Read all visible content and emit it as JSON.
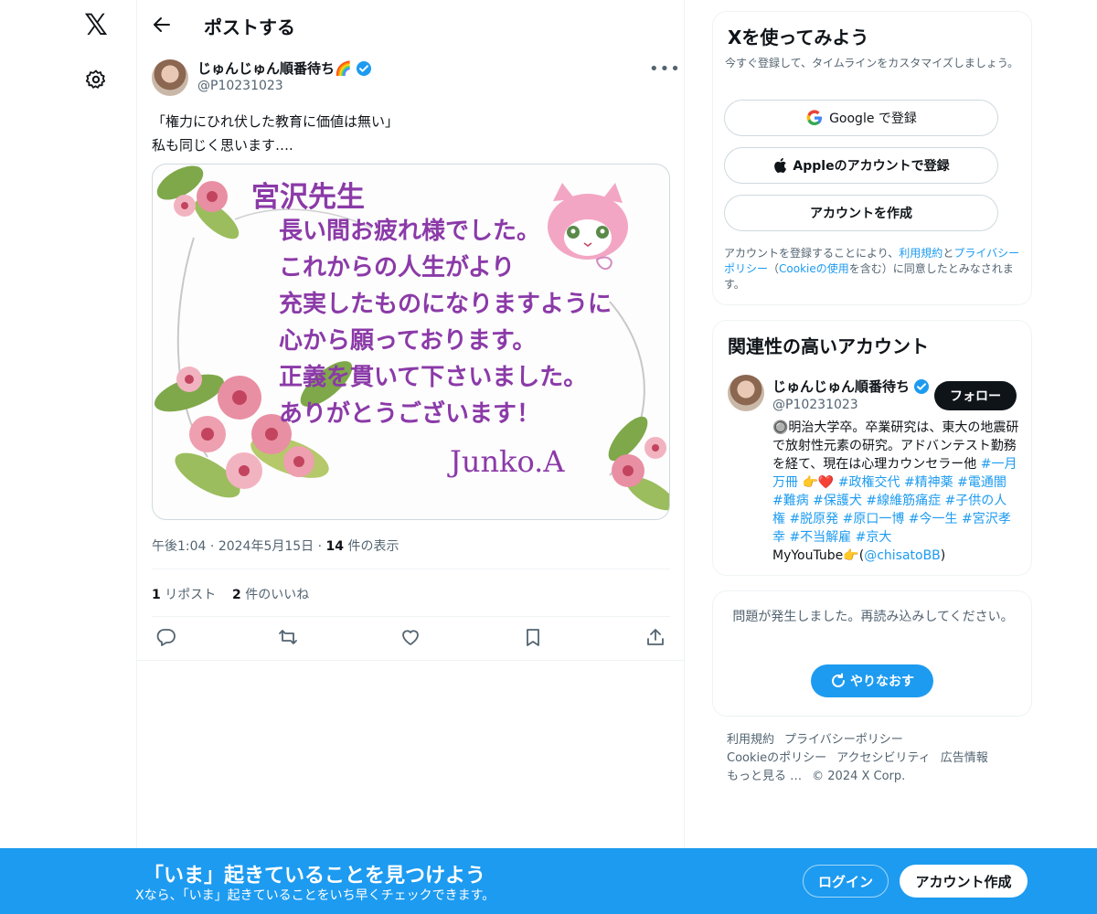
{
  "nav": {
    "logo_text": "𝕏"
  },
  "header": {
    "title": "ポストする"
  },
  "post": {
    "author_name": "じゅんじゅん順番待ち🌈",
    "author_handle": "@P10231023",
    "text_lines": [
      "「権力にひれ伏した教育に価値は無い」",
      "私も同じく思います….",
      ""
    ],
    "image_lines": [
      "宮沢先生",
      "長い間お疲れ様でした。",
      "これからの人生がより",
      "充実したものになりますように",
      "心から願っております。",
      "正義を貫いて下さいました。",
      "ありがとうございます！",
      "Junko.A"
    ],
    "time": "午後1:04",
    "date": "2024年5月15日",
    "views_count": "14",
    "views_label": "件の表示",
    "reposts_count": "1",
    "reposts_label": "リポスト",
    "likes_count": "2",
    "likes_label": "件のいいね"
  },
  "signup_box": {
    "title": "Xを使ってみよう",
    "subtitle": "今すぐ登録して、タイムラインをカスタマイズしましょう。",
    "google_label": "Google で登録",
    "apple_label": "Appleのアカウントで登録",
    "create_label": "アカウントを作成",
    "legal_prefix": "アカウントを登録することにより、",
    "legal_terms": "利用規約",
    "legal_and": "と",
    "legal_privacy": "プライバシーポリシー",
    "legal_paren_open": "（",
    "legal_cookie": "Cookieの使用",
    "legal_suffix": "を含む）に同意したとみなされます。"
  },
  "related": {
    "title": "関連性の高いアカウント",
    "name": "じゅんじゅん順番待ち",
    "handle": "@P10231023",
    "follow_label": "フォロー",
    "bio_text": "🔘明治大学卒。卒業研究は、東大の地震研で放射性元素の研究。アドバンテスト勤務を経て、現在は心理カウンセラー他 ",
    "bio_tags": "#一月万冊 👉❤️ #政権交代 #精神薬 #電通闇 #難病 #保護犬 #線維筋痛症 #子供の人権 #脱原発 #原口一博 #今一生 #宮沢孝幸 #不当解雇 #京大",
    "bio_yt": "MyYouTube👉(",
    "bio_link": "@chisatoBB",
    "bio_close": ")"
  },
  "error_box": {
    "message": "問題が発生しました。再読み込みしてください。",
    "retry_label": "やりなおす"
  },
  "footer": {
    "links": [
      "利用規約",
      "プライバシーポリシー",
      "Cookieのポリシー",
      "アクセシビリティ",
      "広告情報",
      "もっと見る …",
      "© 2024 X Corp."
    ]
  },
  "bottom_bar": {
    "title": "「いま」起きていることを見つけよう",
    "subtitle": "Xなら、「いま」起きていることをいち早くチェックできます。",
    "login_label": "ログイン",
    "signup_label": "アカウント作成"
  },
  "colors": {
    "accent": "#1d9bf0",
    "text": "#0f1419",
    "muted": "#536471",
    "image_text": "#8b3aa8"
  }
}
